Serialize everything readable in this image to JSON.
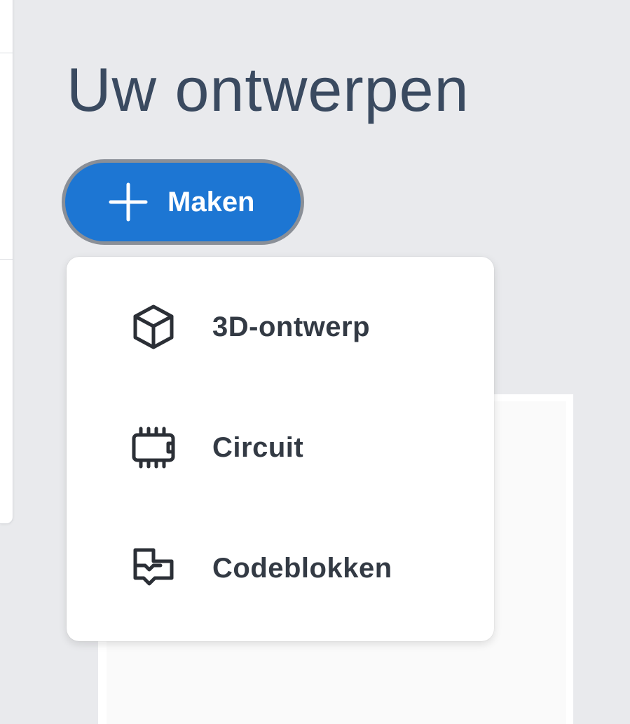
{
  "header": {
    "title": "Uw ontwerpen"
  },
  "create_button": {
    "label": "Maken",
    "icon": "plus-icon",
    "color": "#1d76d3"
  },
  "create_menu": {
    "items": [
      {
        "label": "3D-ontwerp",
        "icon": "cube-icon"
      },
      {
        "label": "Circuit",
        "icon": "chip-icon"
      },
      {
        "label": "Codeblokken",
        "icon": "code-blocks-icon"
      }
    ]
  }
}
